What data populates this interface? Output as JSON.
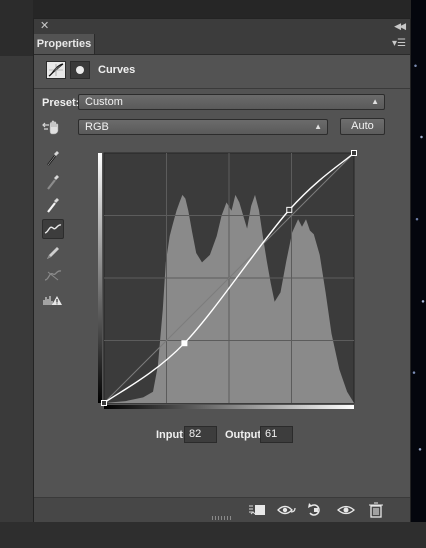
{
  "panel": {
    "tab_label": "Properties",
    "header_title": "Curves"
  },
  "preset": {
    "label": "Preset:",
    "value": "Custom"
  },
  "channel": {
    "value": "RGB",
    "auto_label": "Auto"
  },
  "curve": {
    "points": [
      [
        0,
        0
      ],
      [
        82,
        61
      ],
      [
        189,
        197
      ],
      [
        255,
        255
      ]
    ],
    "selected_point": 1
  },
  "readout": {
    "input_label": "Input:",
    "input_value": "82",
    "output_label": "Output:",
    "output_value": "61"
  },
  "colors": {
    "panel_bg": "#535353",
    "graph_bg": "#3b3b3b",
    "histogram": "#8a8a8a",
    "curve": "#ffffff"
  },
  "icons": {
    "tools": [
      "on-image-adjust-icon",
      "black-point-eyedropper-icon",
      "gray-point-eyedropper-icon",
      "white-point-eyedropper-icon",
      "curve-edit-points-icon",
      "pencil-draw-icon",
      "smooth-curve-icon",
      "clipping-warning-icon"
    ],
    "footer": [
      "clip-to-layer-icon",
      "view-previous-state-icon",
      "reset-icon",
      "visibility-icon",
      "delete-icon"
    ]
  }
}
